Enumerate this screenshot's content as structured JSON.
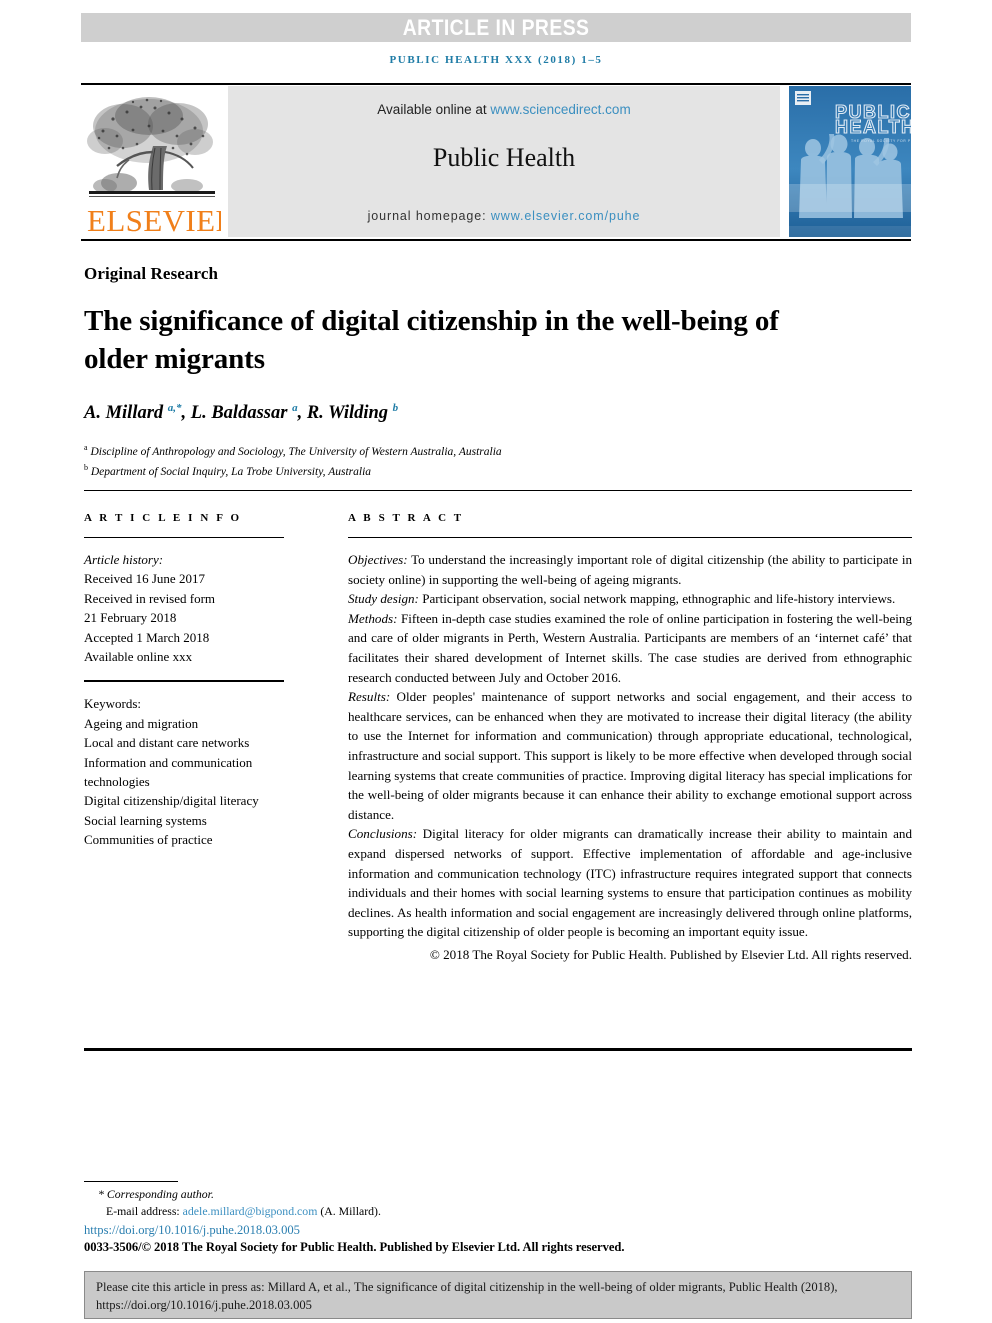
{
  "banner": {
    "label": "ARTICLE IN PRESS"
  },
  "running_head": "PUBLIC HEALTH XXX (2018) 1–5",
  "journal_header": {
    "available_prefix": "Available online at ",
    "sciencedirect_url": "www.sciencedirect.com",
    "journal_title": "Public Health",
    "homepage_prefix": "journal homepage: ",
    "homepage_url": "www.elsevier.com/puhe",
    "publisher_logo_text": "ELSEVIER",
    "cover_line1": "PUBLIC",
    "cover_line2": "HEALTH"
  },
  "article": {
    "type": "Original Research",
    "title": "The significance of digital citizenship in the well-being of older migrants",
    "authors": "A. Millard a,*, L. Baldassar a, R. Wilding b",
    "affiliation_a": "Discipline of Anthropology and Sociology, The University of Western Australia, Australia",
    "affiliation_b": "Department of Social Inquiry, La Trobe University, Australia"
  },
  "article_info": {
    "heading": "A R T I C L E  I N F O",
    "history_label": "Article history:",
    "history": [
      "Received 16 June 2017",
      "Received in revised form",
      "21 February 2018",
      "Accepted 1 March 2018",
      "Available online xxx"
    ],
    "keywords_label": "Keywords:",
    "keywords": [
      "Ageing and migration",
      "Local and distant care networks",
      "Information and communication",
      "technologies",
      "Digital citizenship/digital literacy",
      "Social learning systems",
      "Communities of practice"
    ]
  },
  "abstract": {
    "heading": "A B S T R A C T",
    "sections": [
      {
        "label": "Objectives:",
        "text": " To understand the increasingly important role of digital citizenship (the ability to participate in society online) in supporting the well-being of ageing migrants."
      },
      {
        "label": "Study design:",
        "text": " Participant observation, social network mapping, ethnographic and life-history interviews."
      },
      {
        "label": "Methods:",
        "text": " Fifteen in-depth case studies examined the role of online participation in fostering the well-being and care of older migrants in Perth, Western Australia. Participants are members of an ‘internet café’ that facilitates their shared development of Internet skills. The case studies are derived from ethnographic research conducted between July and October 2016."
      },
      {
        "label": "Results:",
        "text": " Older peoples' maintenance of support networks and social engagement, and their access to healthcare services, can be enhanced when they are motivated to increase their digital literacy (the ability to use the Internet for information and communication) through appropriate educational, technological, infrastructure and social support. This support is likely to be more effective when developed through social learning systems that create communities of practice. Improving digital literacy has special implications for the well-being of older migrants because it can enhance their ability to exchange emotional support across distance."
      },
      {
        "label": "Conclusions:",
        "text": " Digital literacy for older migrants can dramatically increase their ability to maintain and expand dispersed networks of support. Effective implementation of affordable and age-inclusive information and communication technology (ITC) infrastructure requires integrated support that connects individuals and their homes with social learning systems to ensure that participation continues as mobility declines. As health information and social engagement are increasingly delivered through online platforms, supporting the digital citizenship of older people is becoming an important equity issue."
      }
    ],
    "copyright": "© 2018 The Royal Society for Public Health. Published by Elsevier Ltd. All rights reserved."
  },
  "footer": {
    "corresponding_author": "* Corresponding author.",
    "email_label": "E-mail address: ",
    "email": "adele.millard@bigpond.com",
    "email_suffix": " (A. Millard).",
    "doi": "https://doi.org/10.1016/j.puhe.2018.03.005",
    "issn_line": "0033-3506/© 2018 The Royal Society for Public Health. Published by Elsevier Ltd. All rights reserved.",
    "cite_note": "Please cite this article in press as: Millard A, et al., The significance of digital citizenship in the well-being of older migrants, Public Health (2018), https://doi.org/10.1016/j.puhe.2018.03.005"
  },
  "colors": {
    "banner_bg": "#cfcfcf",
    "link_blue": "#3b8fc0",
    "running_head_blue": "#1f7ca6",
    "elsevier_orange": "#f07f1a",
    "header_panel_bg": "#e4e4e4",
    "cite_box_bg": "#c9c9c9",
    "cover_blue": "#2d74ad"
  }
}
